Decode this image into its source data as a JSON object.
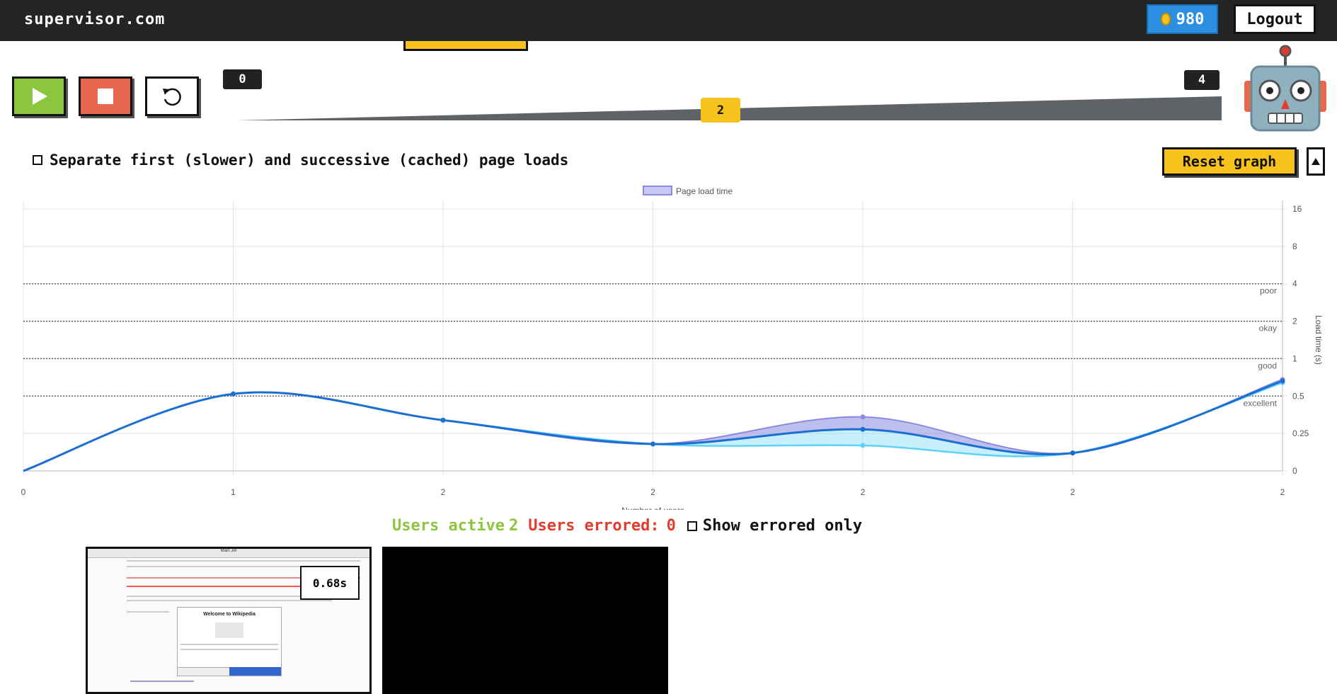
{
  "header": {
    "brand": "supervisor.com",
    "coins": "980",
    "logout_label": "Logout"
  },
  "controls": {
    "play_icon": "play-icon",
    "stop_icon": "stop-icon",
    "reset_icon": "reset-icon"
  },
  "slider": {
    "min_label": "0",
    "max_label": "4",
    "current_label": "2",
    "value": 2
  },
  "options": {
    "separate_label": "Separate first (slower) and successive (cached) page loads",
    "separate_checked": false,
    "reset_graph_label": "Reset graph",
    "collapse_icon": "triangle-up-icon"
  },
  "chart_data": {
    "type": "line",
    "legend": "Page load time",
    "xlabel": "Number of users",
    "ylabel": "Load time (s)",
    "x_tick_labels": [
      "0",
      "1",
      "2",
      "2",
      "2",
      "2",
      "2"
    ],
    "y_ticks": [
      "0",
      "0.25",
      "0.5",
      "1",
      "2",
      "4",
      "8",
      "16"
    ],
    "thresholds": [
      {
        "label": "excellent",
        "value": 0.5
      },
      {
        "label": "good",
        "value": 1
      },
      {
        "label": "okay",
        "value": 2
      },
      {
        "label": "poor",
        "value": 4
      }
    ],
    "series": [
      {
        "values": [
          0,
          0.52,
          0.32,
          0.18,
          0.27,
          0.12,
          0.66
        ]
      },
      {
        "values": [
          0,
          0.52,
          0.32,
          0.18,
          0.34,
          0.12,
          0.68
        ]
      },
      {
        "values": [
          0,
          0.52,
          0.32,
          0.18,
          0.17,
          0.12,
          0.64
        ]
      }
    ],
    "colors": {
      "line": "#1b6fd0",
      "band_upper": "#8a8ae0",
      "band_lower": "#5fd3f5",
      "grid": "#e4e4e4"
    }
  },
  "stats": {
    "active_label": "Users active",
    "active_count": "2",
    "errored_label": "Users errored:",
    "errored_count": "0",
    "show_errored_label": "Show errored only"
  },
  "thumbnails": [
    {
      "timing": "0.68s",
      "title": "Main Jet",
      "modal_title": "Welcome to Wikipedia"
    }
  ]
}
